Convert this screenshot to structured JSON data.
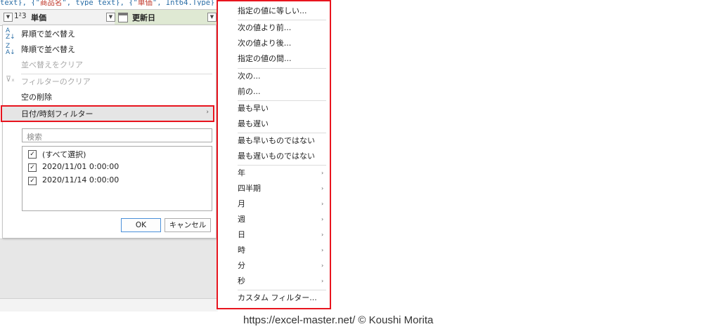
{
  "formula_bar": {
    "part1": "text}, {\"",
    "part2": "商品名",
    "part3": "\", type text}, {\"",
    "part4": "単価",
    "part5": "\", Int64.Type}"
  },
  "header": {
    "type_indicator": "1²3",
    "column1": "単価",
    "column2": "更新日"
  },
  "menu": {
    "sort_asc": "昇順で並べ替え",
    "sort_desc": "降順で並べ替え",
    "clear_sort": "並べ替えをクリア",
    "clear_filter": "フィルターのクリア",
    "remove_empty": "空の削除",
    "date_filter": "日付/時刻フィルター",
    "search_placeholder": "検索",
    "list": [
      {
        "label": "(すべて選択)",
        "checked": true
      },
      {
        "label": "2020/11/01 0:00:00",
        "checked": true
      },
      {
        "label": "2020/11/14 0:00:00",
        "checked": true
      }
    ],
    "ok": "OK",
    "cancel": "キャンセル"
  },
  "submenu": {
    "items": [
      "指定の値に等しい...",
      "次の値より前...",
      "次の値より後...",
      "指定の値の間...",
      "次の...",
      "前の...",
      "最も早い",
      "最も遅い",
      "最も早いものではない",
      "最も遅いものではない",
      "年",
      "四半期",
      "月",
      "週",
      "日",
      "時",
      "分",
      "秒",
      "カスタム フィルター..."
    ]
  },
  "footer": "https://excel-master.net/  © Koushi Morita",
  "colors": {
    "highlight_border": "#e8141e",
    "accent": "#2b6ea6"
  }
}
